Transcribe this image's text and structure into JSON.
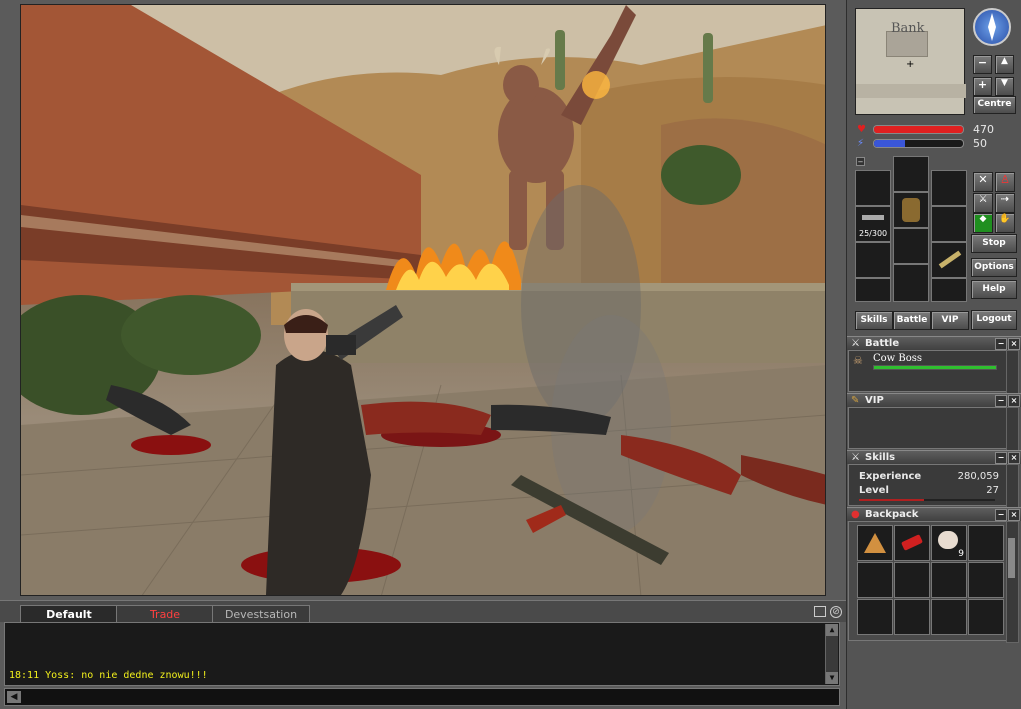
{
  "chat": {
    "tabs": [
      {
        "label": "Default",
        "color": "#ffffff"
      },
      {
        "label": "Trade",
        "color": "#ff4040"
      },
      {
        "label": "Devestsation",
        "color": "#b8b8b8"
      }
    ],
    "log": [
      {
        "text": "18:11 Yoss: no nie dedne znowu!!!",
        "color": "#f2f01c"
      }
    ],
    "input_value": ""
  },
  "minimap": {
    "label": "Bank",
    "centre_button": "Centre"
  },
  "stats": {
    "health": 470,
    "health_fill": 1.0,
    "mana": 50,
    "mana_fill": 0.35,
    "health_color": "#e02020",
    "mana_color": "#3a56d8"
  },
  "equipment": {
    "ammo": "25/300"
  },
  "side_buttons": {
    "stop": "Stop",
    "options": "Options",
    "help": "Help",
    "logout": "Logout"
  },
  "tab_buttons": {
    "skills": "Skills",
    "battle": "Battle",
    "vip": "VIP"
  },
  "battle": {
    "title": "Battle",
    "target_name": "Cow Boss",
    "target_health_fill": 1.0,
    "bar_color": "#2fbf2f"
  },
  "vip": {
    "title": "VIP"
  },
  "skills": {
    "title": "Skills",
    "experience_label": "Experience",
    "experience_value": "280,059",
    "level_label": "Level",
    "level_value": "27",
    "level_progress": 0.48
  },
  "backpack": {
    "title": "Backpack",
    "items": [
      {
        "name": "pizza-icon",
        "count": ""
      },
      {
        "name": "dynamite-icon",
        "count": ""
      },
      {
        "name": "cat-head-icon",
        "count": "9"
      }
    ]
  }
}
